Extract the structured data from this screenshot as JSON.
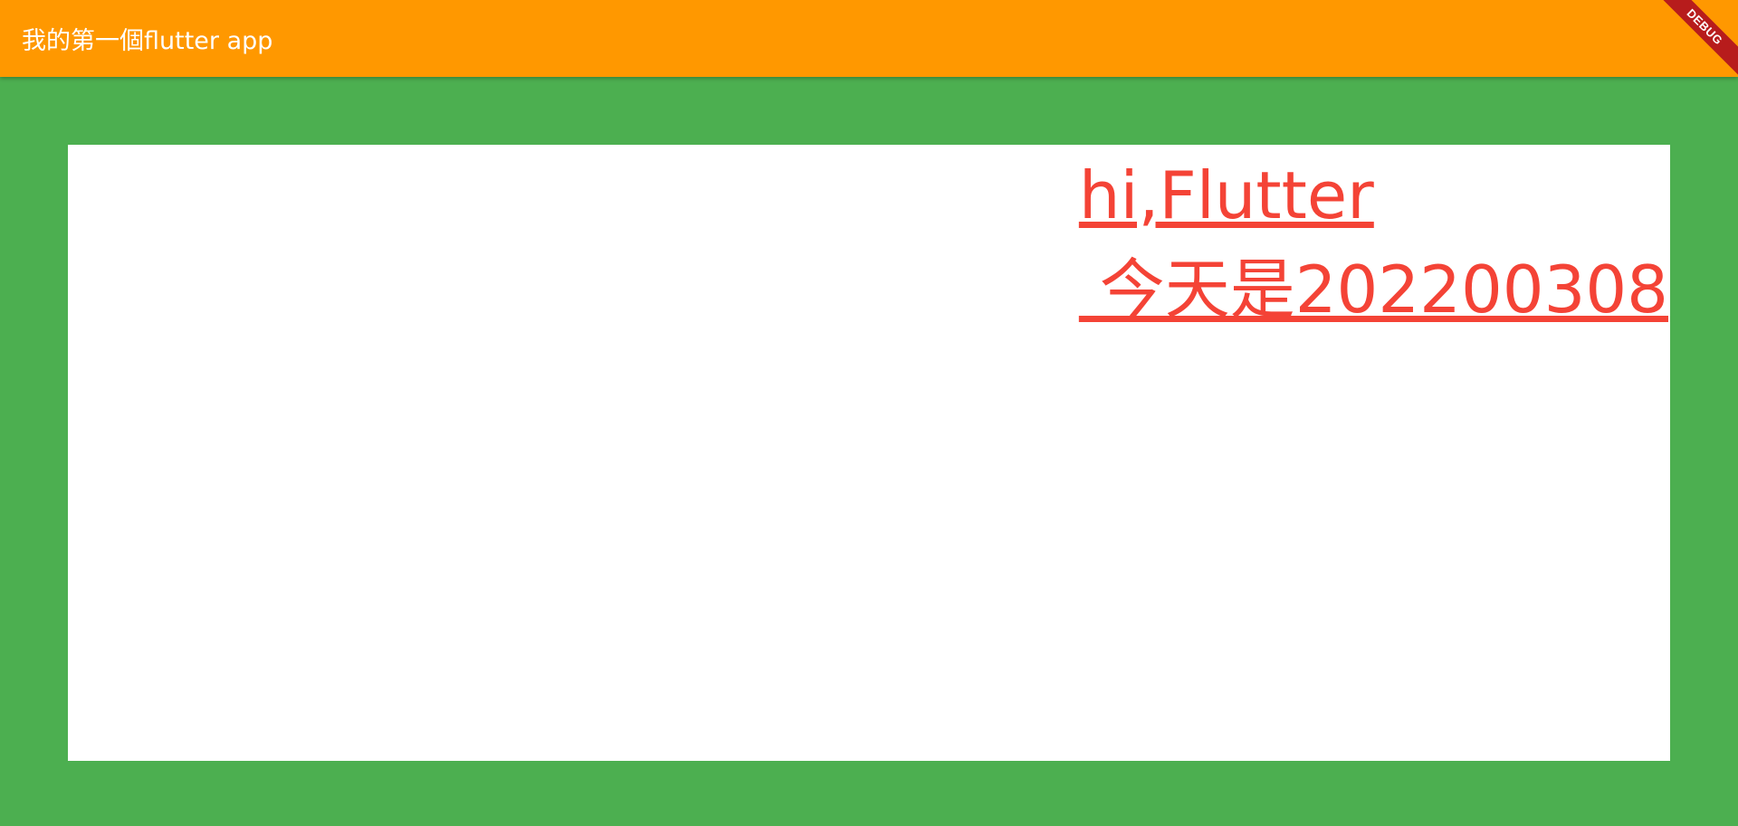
{
  "appbar": {
    "title": "我的第一個flutter app",
    "background_color": "#ff9800",
    "title_color": "#ffffff"
  },
  "debug_banner": {
    "label": "DEBUG",
    "color": "#b71c1c"
  },
  "body": {
    "background_color": "#4caf50",
    "container_color": "#ffffff"
  },
  "content": {
    "text": "hi,Flutter\n 今天是202200308",
    "text_color": "#f44336",
    "underlined": true
  }
}
